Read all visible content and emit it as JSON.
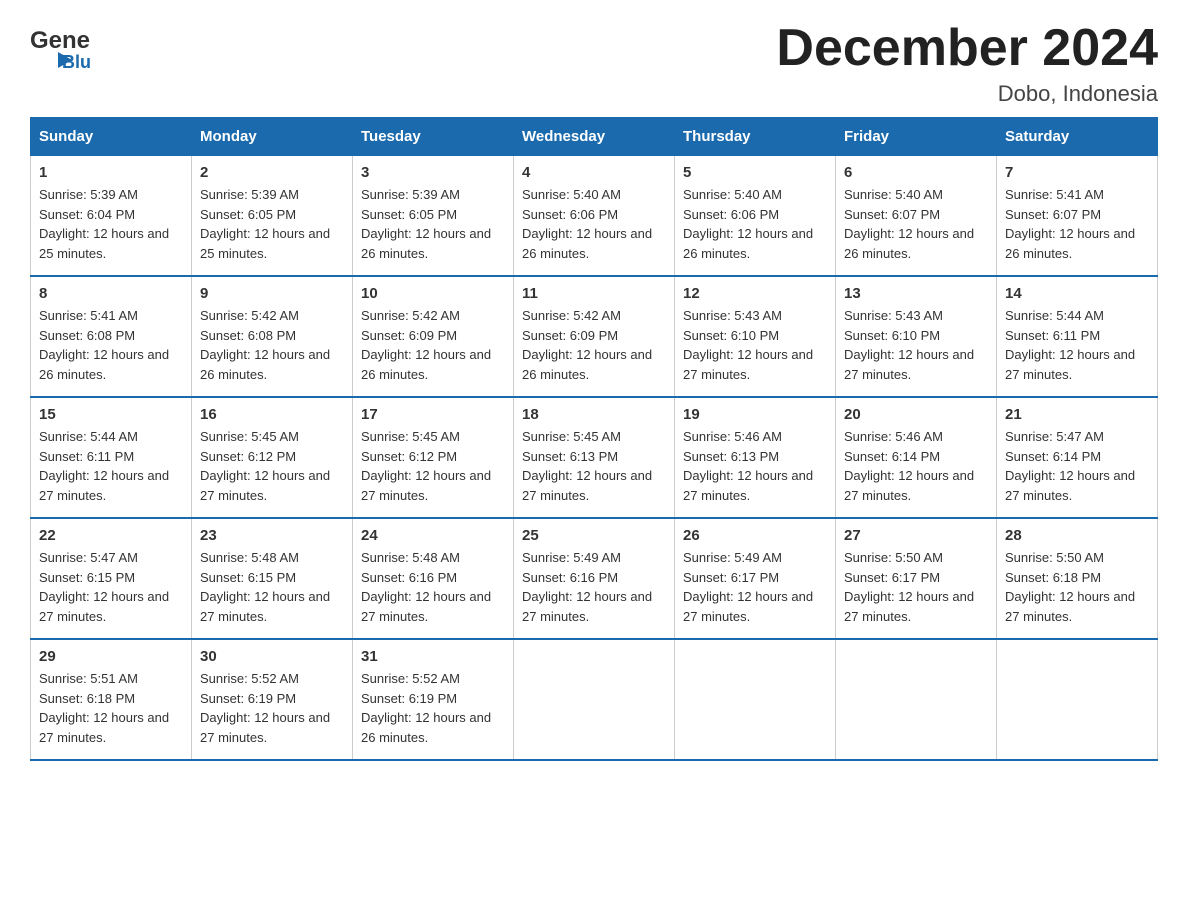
{
  "logo": {
    "text_general": "General",
    "text_blue": "Blue"
  },
  "title": "December 2024",
  "subtitle": "Dobo, Indonesia",
  "weekdays": [
    "Sunday",
    "Monday",
    "Tuesday",
    "Wednesday",
    "Thursday",
    "Friday",
    "Saturday"
  ],
  "weeks": [
    [
      {
        "day": "1",
        "sunrise": "5:39 AM",
        "sunset": "6:04 PM",
        "daylight": "12 hours and 25 minutes."
      },
      {
        "day": "2",
        "sunrise": "5:39 AM",
        "sunset": "6:05 PM",
        "daylight": "12 hours and 25 minutes."
      },
      {
        "day": "3",
        "sunrise": "5:39 AM",
        "sunset": "6:05 PM",
        "daylight": "12 hours and 26 minutes."
      },
      {
        "day": "4",
        "sunrise": "5:40 AM",
        "sunset": "6:06 PM",
        "daylight": "12 hours and 26 minutes."
      },
      {
        "day": "5",
        "sunrise": "5:40 AM",
        "sunset": "6:06 PM",
        "daylight": "12 hours and 26 minutes."
      },
      {
        "day": "6",
        "sunrise": "5:40 AM",
        "sunset": "6:07 PM",
        "daylight": "12 hours and 26 minutes."
      },
      {
        "day": "7",
        "sunrise": "5:41 AM",
        "sunset": "6:07 PM",
        "daylight": "12 hours and 26 minutes."
      }
    ],
    [
      {
        "day": "8",
        "sunrise": "5:41 AM",
        "sunset": "6:08 PM",
        "daylight": "12 hours and 26 minutes."
      },
      {
        "day": "9",
        "sunrise": "5:42 AM",
        "sunset": "6:08 PM",
        "daylight": "12 hours and 26 minutes."
      },
      {
        "day": "10",
        "sunrise": "5:42 AM",
        "sunset": "6:09 PM",
        "daylight": "12 hours and 26 minutes."
      },
      {
        "day": "11",
        "sunrise": "5:42 AM",
        "sunset": "6:09 PM",
        "daylight": "12 hours and 26 minutes."
      },
      {
        "day": "12",
        "sunrise": "5:43 AM",
        "sunset": "6:10 PM",
        "daylight": "12 hours and 27 minutes."
      },
      {
        "day": "13",
        "sunrise": "5:43 AM",
        "sunset": "6:10 PM",
        "daylight": "12 hours and 27 minutes."
      },
      {
        "day": "14",
        "sunrise": "5:44 AM",
        "sunset": "6:11 PM",
        "daylight": "12 hours and 27 minutes."
      }
    ],
    [
      {
        "day": "15",
        "sunrise": "5:44 AM",
        "sunset": "6:11 PM",
        "daylight": "12 hours and 27 minutes."
      },
      {
        "day": "16",
        "sunrise": "5:45 AM",
        "sunset": "6:12 PM",
        "daylight": "12 hours and 27 minutes."
      },
      {
        "day": "17",
        "sunrise": "5:45 AM",
        "sunset": "6:12 PM",
        "daylight": "12 hours and 27 minutes."
      },
      {
        "day": "18",
        "sunrise": "5:45 AM",
        "sunset": "6:13 PM",
        "daylight": "12 hours and 27 minutes."
      },
      {
        "day": "19",
        "sunrise": "5:46 AM",
        "sunset": "6:13 PM",
        "daylight": "12 hours and 27 minutes."
      },
      {
        "day": "20",
        "sunrise": "5:46 AM",
        "sunset": "6:14 PM",
        "daylight": "12 hours and 27 minutes."
      },
      {
        "day": "21",
        "sunrise": "5:47 AM",
        "sunset": "6:14 PM",
        "daylight": "12 hours and 27 minutes."
      }
    ],
    [
      {
        "day": "22",
        "sunrise": "5:47 AM",
        "sunset": "6:15 PM",
        "daylight": "12 hours and 27 minutes."
      },
      {
        "day": "23",
        "sunrise": "5:48 AM",
        "sunset": "6:15 PM",
        "daylight": "12 hours and 27 minutes."
      },
      {
        "day": "24",
        "sunrise": "5:48 AM",
        "sunset": "6:16 PM",
        "daylight": "12 hours and 27 minutes."
      },
      {
        "day": "25",
        "sunrise": "5:49 AM",
        "sunset": "6:16 PM",
        "daylight": "12 hours and 27 minutes."
      },
      {
        "day": "26",
        "sunrise": "5:49 AM",
        "sunset": "6:17 PM",
        "daylight": "12 hours and 27 minutes."
      },
      {
        "day": "27",
        "sunrise": "5:50 AM",
        "sunset": "6:17 PM",
        "daylight": "12 hours and 27 minutes."
      },
      {
        "day": "28",
        "sunrise": "5:50 AM",
        "sunset": "6:18 PM",
        "daylight": "12 hours and 27 minutes."
      }
    ],
    [
      {
        "day": "29",
        "sunrise": "5:51 AM",
        "sunset": "6:18 PM",
        "daylight": "12 hours and 27 minutes."
      },
      {
        "day": "30",
        "sunrise": "5:52 AM",
        "sunset": "6:19 PM",
        "daylight": "12 hours and 27 minutes."
      },
      {
        "day": "31",
        "sunrise": "5:52 AM",
        "sunset": "6:19 PM",
        "daylight": "12 hours and 26 minutes."
      },
      null,
      null,
      null,
      null
    ]
  ]
}
